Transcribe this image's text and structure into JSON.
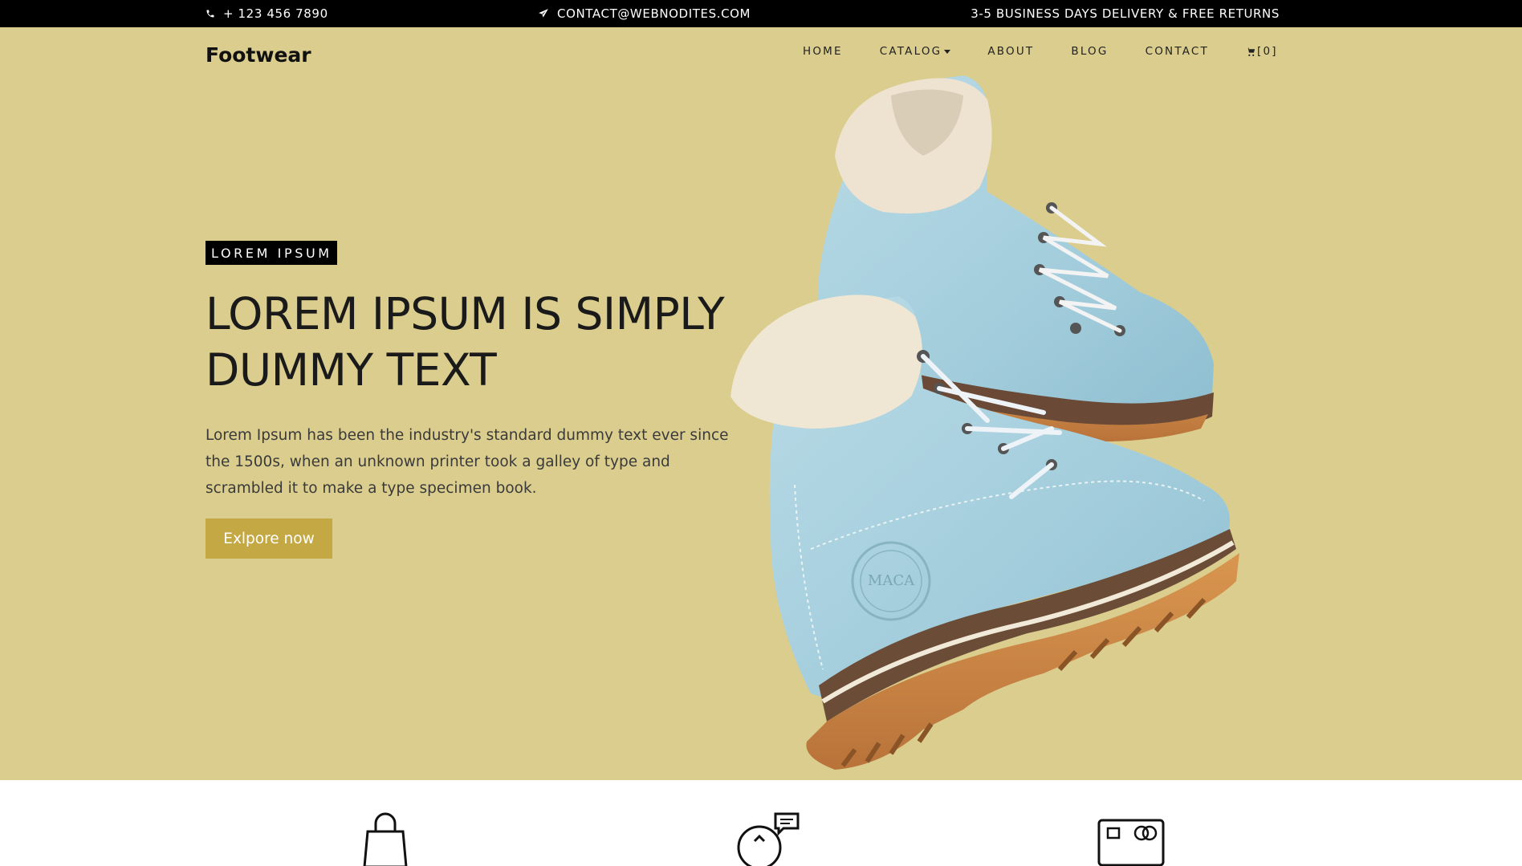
{
  "topbar": {
    "phone": "+ 123 456 7890",
    "email": "CONTACT@WEBNODITES.COM",
    "delivery": "3-5 BUSINESS DAYS DELIVERY & FREE RETURNS"
  },
  "header": {
    "brand": "Footwear",
    "nav": {
      "home": "HOME",
      "catalog": "CATALOG",
      "about": "ABOUT",
      "blog": "BLOG",
      "contact": "CONTACT",
      "cart": "[0]"
    }
  },
  "hero": {
    "badge": "LOREM IPSUM",
    "headline": "LOREM IPSUM IS SIMPLY DUMMY TEXT",
    "description": "Lorem Ipsum has been the industry's standard dummy text ever since the 1500s, when an unknown printer took a galley of type and scrambled it to make a type specimen book.",
    "cta": "Exlpore now",
    "image_alt": "boots",
    "boot_stamp": "MACA"
  },
  "colors": {
    "hero_bg": "#dacd8e",
    "cta": "#c4a843",
    "topbar": "#000000"
  },
  "icons": [
    "phone-icon",
    "paper-plane-icon",
    "cart-icon",
    "shopping-bag-icon",
    "support-chat-icon",
    "card-payment-icon"
  ]
}
